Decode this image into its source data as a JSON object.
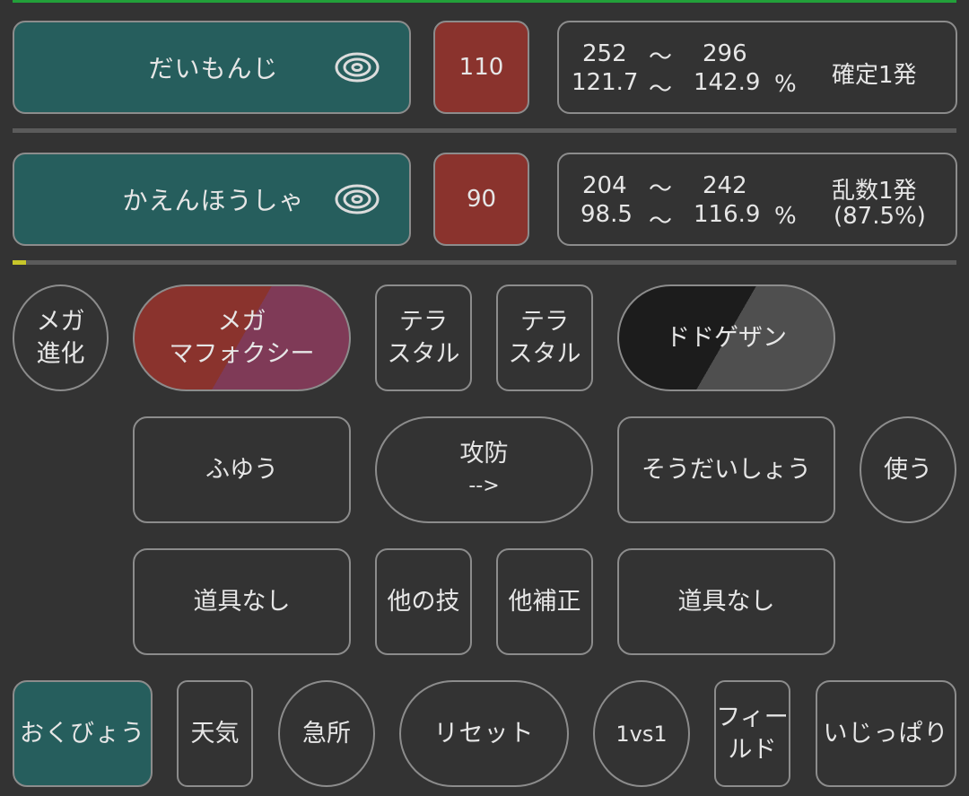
{
  "moves": [
    {
      "name": "だいもんじ",
      "category_icon": "special-category-icon",
      "power": "110",
      "damage": {
        "min": "252",
        "sep": "～",
        "max": "296",
        "min_pct": "121.7",
        "max_pct": "142.9",
        "pct_sign": "%",
        "result_line1": "確定1発",
        "result_line2": ""
      }
    },
    {
      "name": "かえんほうしゃ",
      "category_icon": "special-category-icon",
      "power": "90",
      "damage": {
        "min": "204",
        "sep": "～",
        "max": "242",
        "min_pct": "98.5",
        "max_pct": "116.9",
        "pct_sign": "%",
        "result_line1": "乱数1発",
        "result_line2": "(87.5%)"
      }
    }
  ],
  "hp_bar": {
    "fill_fraction": 0.014
  },
  "row1": {
    "mega_evolve": {
      "line1": "メガ",
      "line2": "進化"
    },
    "attacker_pokemon": {
      "line1": "メガ",
      "line2": "マフォクシー"
    },
    "tera_attacker": {
      "line1": "テラ",
      "line2": "スタル"
    },
    "tera_defender": {
      "line1": "テラ",
      "line2": "スタル"
    },
    "defender_pokemon": {
      "label": "ドドゲザン"
    }
  },
  "row2": {
    "attacker_ability": "ふゆう",
    "swap": {
      "line1": "攻防",
      "line2": "-->"
    },
    "defender_ability": "そうだいしょう",
    "use": "使う"
  },
  "row3": {
    "attacker_item": "道具なし",
    "other_moves": "他の技",
    "other_modifiers": "他補正",
    "defender_item": "道具なし"
  },
  "row4": {
    "attacker_nature": "おくびょう",
    "weather": "天気",
    "critical": "急所",
    "reset": "リセット",
    "mode": "1vs1",
    "field": {
      "line1": "フィー",
      "line2": "ルド"
    },
    "defender_nature": "いじっぱり"
  },
  "colors": {
    "teal": "#265e5d",
    "red": "#8a332d",
    "magenta": "#7f3a57",
    "dark_gray": "#4f4f4f",
    "accent_green": "#23a03a",
    "accent_yellow": "#c7c62a"
  }
}
